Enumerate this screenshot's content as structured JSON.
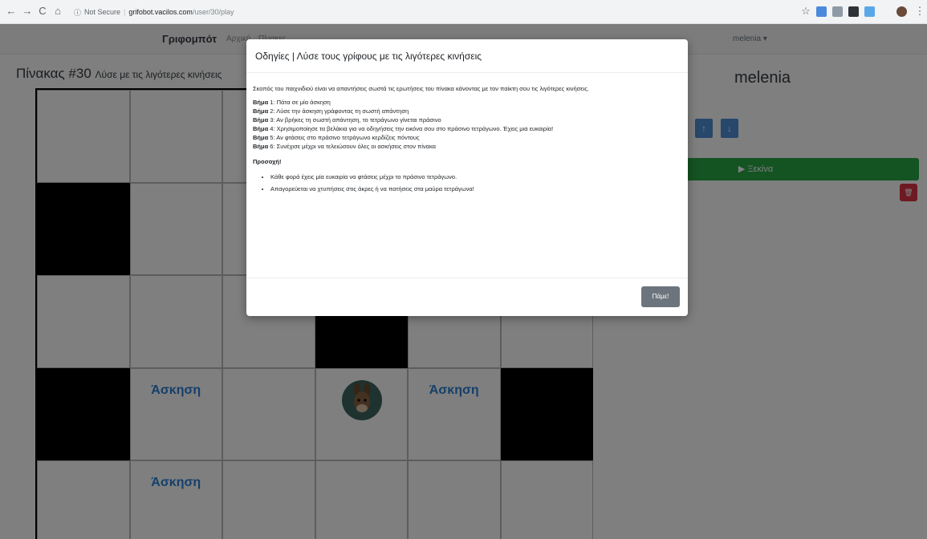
{
  "browser": {
    "back_icon": "←",
    "forward_icon": "→",
    "reload_icon": "C",
    "home_icon": "⌂",
    "security": "Not Secure",
    "host": "grifobot.vacilos.com",
    "path": "/user/30/play",
    "star_icon": "☆"
  },
  "nav": {
    "brand": "Γριφομπότ",
    "link1": "Αρχική",
    "link2": "Πίνακες",
    "user_menu": "melenia ▾"
  },
  "board": {
    "title": "Πίνακας #30",
    "subtitle": "Λύσε με τις λιγότερες κινήσεις",
    "cell_label": "Άσκηση",
    "cells_black": [
      "1,0",
      "3,0",
      "2,3",
      "3,5"
    ],
    "cells_exercise": [
      "3,1",
      "3,4",
      "4,1"
    ],
    "player_cell": "3,3"
  },
  "sidebar": {
    "player_name": "melenia",
    "up_icon": "↑",
    "down_icon": "↓",
    "start_label": "▶ Ξεκίνα",
    "delete_icon": "🗑"
  },
  "modal": {
    "title": "Οδηγίες | Λύσε τους γρίφους με τις λιγότερες κινήσεις",
    "intro": "Σκοπός του παιχνιδιού είναι να απαντήσεις σωστά τις ερωτήσεις του πίνακα κάνοντας με τον παίκτη σου τις λιγότερες κινήσεις.",
    "steps": [
      {
        "label": "Βήμα",
        "num": "1",
        "text": ": Πάτα σε μία άσκηση"
      },
      {
        "label": "Βήμα",
        "num": "2",
        "text": ": Λύσε την άσκηση γράφοντας τη σωστή απάντηση"
      },
      {
        "label": "Βήμα",
        "num": "3",
        "text": ": Αν βρήκες τη σωστή απάντηση, το τετράγωνο γίνεται πράσινο"
      },
      {
        "label": "Βήμα",
        "num": "4",
        "text": ": Χρησιμοποίησε τα βελάκια για να οδηγήσεις την εικόνα σου στο πράσινο τετράγωνο. Έχεις μια ευκαιρία!"
      },
      {
        "label": "Βήμα",
        "num": "5",
        "text": ": Αν φτάσεις στο πράσινο τετράγωνο κερδίζεις πόντους"
      },
      {
        "label": "Βήμα",
        "num": "6",
        "text": ": Συνέχισε μέχρι να τελειώσουν όλες οι ασκήσεις στον πίνακα"
      }
    ],
    "warning": "Προσοχή!",
    "bullets": [
      "Κάθε φορά έχεις μία ευκαιρία να φτάσεις μέχρι το πράσινο τετράγωνο.",
      "Απαγορεύεται να χτυπήσεις στις άκρες ή να πατήσεις στα μαύρα τετράγωνα!"
    ],
    "ok_label": "Πάμε!"
  }
}
